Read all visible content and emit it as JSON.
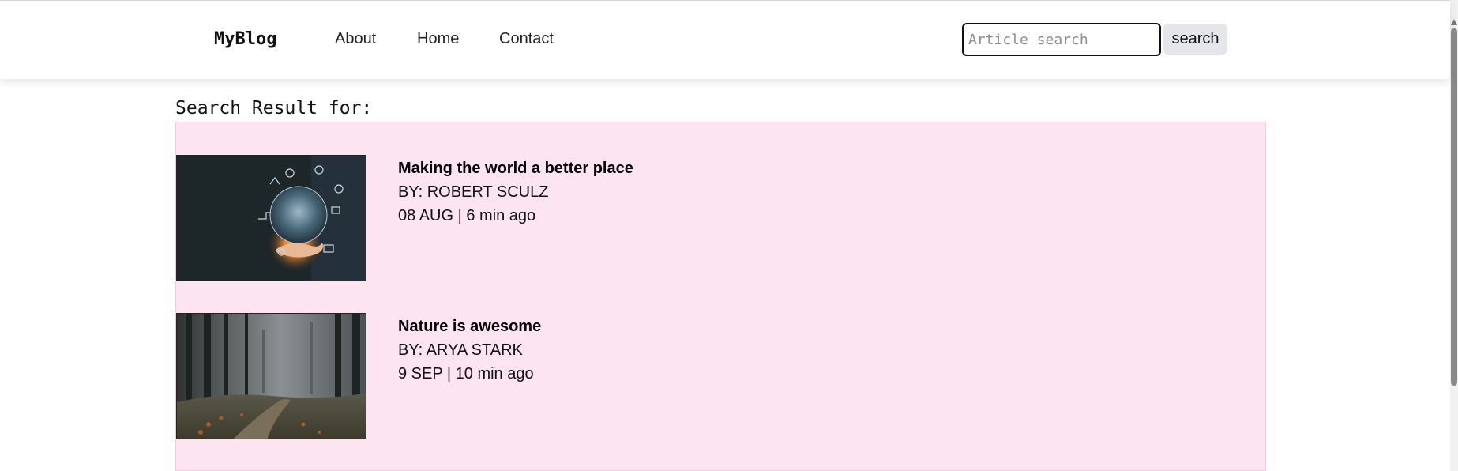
{
  "navbar": {
    "brand": "MyBlog",
    "links": [
      "About",
      "Home",
      "Contact"
    ],
    "search": {
      "placeholder": "Article search",
      "value": "",
      "button_label": "search"
    }
  },
  "main": {
    "heading": "Search Result for:",
    "articles": [
      {
        "title": "Making the world a better place",
        "author": "BY: ROBERT SCULZ",
        "date": "08 AUG | 6 min ago",
        "image": "hand-holding-globe-tech-icons-image"
      },
      {
        "title": "Nature is awesome",
        "author": "BY: ARYA STARK",
        "date": "9 SEP | 10 min ago",
        "image": "misty-forest-path-image"
      }
    ]
  },
  "colors": {
    "results_background": "#fce4f1",
    "button_background": "#e5e6ea"
  }
}
